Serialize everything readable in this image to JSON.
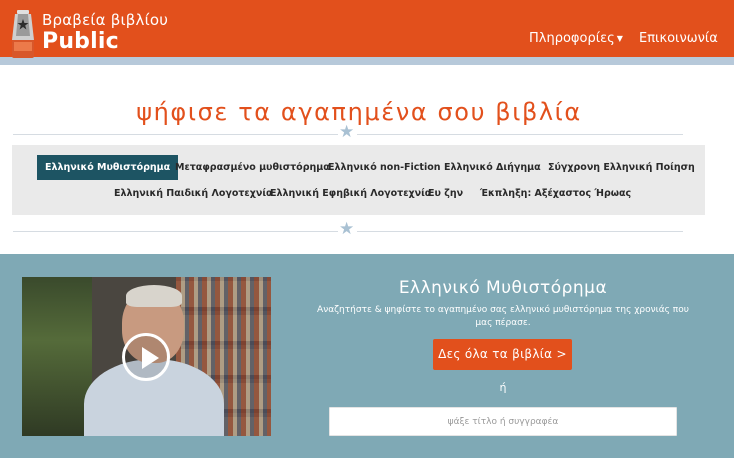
{
  "header": {
    "logo_line1": "Βραβεία βιβλίου",
    "logo_line2": "Public",
    "nav": [
      {
        "label": "Πληροφορίες",
        "has_dropdown": true
      },
      {
        "label": "Επικοινωνία",
        "has_dropdown": false
      }
    ]
  },
  "main": {
    "title": "ψήφισε τα αγαπημένα σου βιβλία",
    "categories": [
      {
        "label": "Ελληνικό Μυθιστόρημα",
        "active": true
      },
      {
        "label": "Μεταφρασμένο μυθιστόρημα",
        "active": false
      },
      {
        "label": "Ελληνικό non-Fiction",
        "active": false
      },
      {
        "label": "Ελληνικό Διήγημα",
        "active": false
      },
      {
        "label": "Σύγχρονη Ελληνική Ποίηση",
        "active": false
      },
      {
        "label": "Ελληνική Παιδική Λογοτεχνία",
        "active": false
      },
      {
        "label": "Ελληνική Εφηβική Λογοτεχνία",
        "active": false
      },
      {
        "label": "Ευ ζην",
        "active": false
      },
      {
        "label": "Έκπληξη: Αξέχαστος Ήρωας",
        "active": false
      }
    ]
  },
  "panel": {
    "title": "Ελληνικό Μυθιστόρημα",
    "description": "Αναζητήστε & ψηφίστε το αγαπημένο σας ελληνικό μυθιστόρημα της χρονιάς που μας πέρασε.",
    "button_label": "Δες όλα τα βιβλία >",
    "or_text": "ή",
    "search_placeholder": "ψάξε τίτλο ή συγγραφέα"
  },
  "colors": {
    "brand_orange": "#e2501c",
    "active_tab": "#1d5463",
    "panel_bg": "#7fa9b5"
  },
  "icons": [
    "trophy-logo-icon",
    "star-icon",
    "play-icon",
    "caret-down-icon"
  ]
}
